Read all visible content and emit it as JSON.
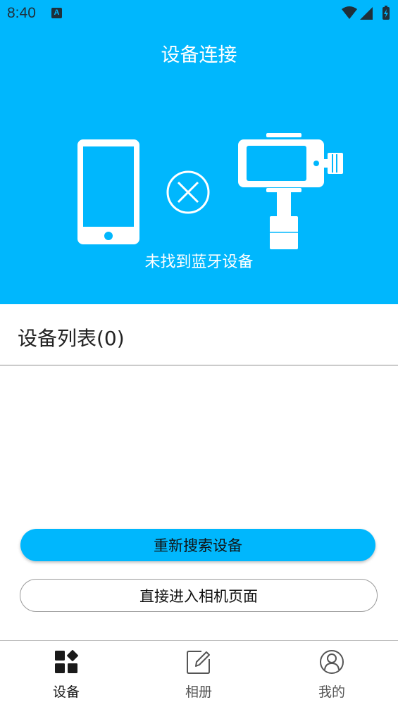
{
  "status_bar": {
    "time": "8:40",
    "notification_badge": "A"
  },
  "header": {
    "title": "设备连接",
    "status_text": "未找到蓝牙设备"
  },
  "device_list": {
    "title": "设备列表(0)"
  },
  "actions": {
    "rescan_label": "重新搜索设备",
    "enter_camera_label": "直接进入相机页面"
  },
  "tabs": [
    {
      "label": "设备",
      "icon": "grid-icon",
      "active": true
    },
    {
      "label": "相册",
      "icon": "edit-icon",
      "active": false
    },
    {
      "label": "我的",
      "icon": "user-icon",
      "active": false
    }
  ],
  "colors": {
    "accent": "#00b7fd"
  }
}
